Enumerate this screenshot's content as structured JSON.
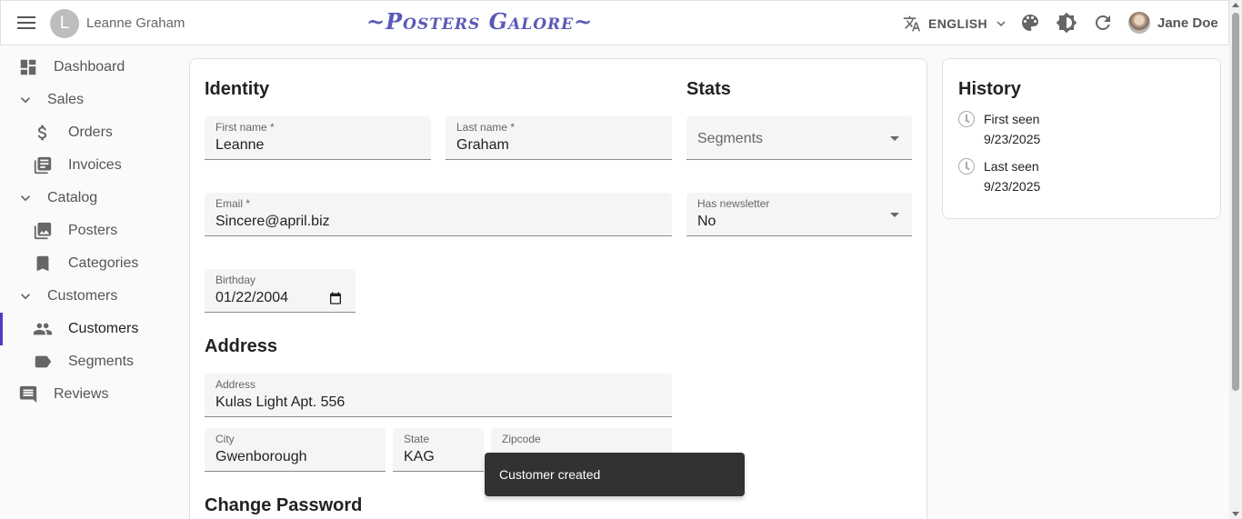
{
  "appbar": {
    "avatar_letter": "L",
    "record_title": "Leanne Graham",
    "logo": "~Posters Galore~",
    "language": "ENGLISH",
    "user_name": "Jane Doe"
  },
  "sidebar": {
    "items": [
      {
        "label": "Dashboard",
        "icon": "dashboard-icon"
      },
      {
        "label": "Sales",
        "icon": "chevron-down-icon"
      },
      {
        "label": "Orders",
        "icon": "dollar-icon"
      },
      {
        "label": "Invoices",
        "icon": "invoices-icon"
      },
      {
        "label": "Catalog",
        "icon": "chevron-down-icon"
      },
      {
        "label": "Posters",
        "icon": "image-icon"
      },
      {
        "label": "Categories",
        "icon": "bookmark-icon"
      },
      {
        "label": "Customers",
        "icon": "chevron-down-icon"
      },
      {
        "label": "Customers",
        "icon": "people-icon"
      },
      {
        "label": "Segments",
        "icon": "label-icon"
      },
      {
        "label": "Reviews",
        "icon": "comment-icon"
      }
    ],
    "active_index": 8
  },
  "form": {
    "identity_title": "Identity",
    "stats_title": "Stats",
    "address_title": "Address",
    "password_title": "Change Password",
    "first_name": {
      "label": "First name *",
      "value": "Leanne"
    },
    "last_name": {
      "label": "Last name *",
      "value": "Graham"
    },
    "segments": {
      "placeholder": "Segments"
    },
    "email": {
      "label": "Email *",
      "value": "Sincere@april.biz"
    },
    "newsletter": {
      "label": "Has newsletter",
      "value": "No"
    },
    "birthday": {
      "label": "Birthday",
      "value": "01/22/2004"
    },
    "address": {
      "label": "Address",
      "value": "Kulas Light Apt. 556"
    },
    "city": {
      "label": "City",
      "value": "Gwenborough"
    },
    "state": {
      "label": "State",
      "value": "KAG"
    },
    "zipcode": {
      "label": "Zipcode",
      "value": ""
    }
  },
  "history": {
    "title": "History",
    "first_seen_label": "First seen",
    "first_seen_value": "9/23/2025",
    "last_seen_label": "Last seen",
    "last_seen_value": "9/23/2025"
  },
  "snackbar": {
    "message": "Customer created"
  },
  "colors": {
    "accent": "#4f3cc9",
    "logo": "#5a5ab8"
  }
}
